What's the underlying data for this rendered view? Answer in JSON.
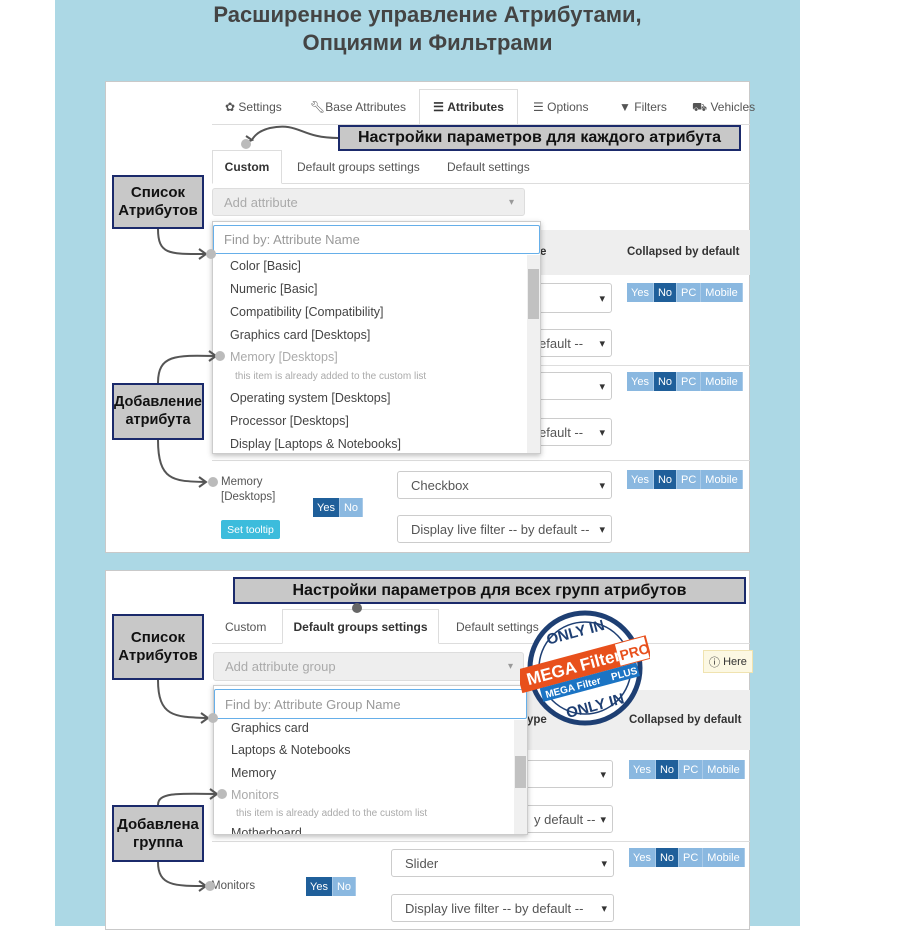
{
  "heading": {
    "line1": "Расширенное управление Атрибутами,",
    "line2": "Опциями и Фильтрами"
  },
  "colors": {
    "band": "#acd8e5",
    "callout_border": "#1b2a6b",
    "toggle_active": "#1f5f9a",
    "toggle_inactive": "#8ab8e0",
    "tooltip_button": "#3cbcdc"
  },
  "main_tabs": [
    {
      "label": "Settings",
      "icon": "gear-icon"
    },
    {
      "label": "Base Attributes",
      "icon": "wrench-icon"
    },
    {
      "label": "Attributes",
      "icon": "list-icon",
      "active": true
    },
    {
      "label": "Options",
      "icon": "list-icon"
    },
    {
      "label": "Filters",
      "icon": "filter-icon"
    },
    {
      "label": "Vehicles",
      "icon": "truck-icon"
    }
  ],
  "panel1": {
    "callout_top": "Настройки параметров для каждого атрибута",
    "callout_list": "Список Атрибутов",
    "callout_add": "Добавление атрибута",
    "subtabs": [
      "Custom",
      "Default groups settings",
      "Default settings"
    ],
    "active_subtab": "Custom",
    "add_placeholder": "Add attribute",
    "search_placeholder": "Find by: Attribute Name",
    "items": [
      "Color [Basic]",
      "Numeric [Basic]",
      "Compatibility [Compatibility]",
      "Graphics card [Desktops]",
      "Memory [Desktops]",
      "Operating system [Desktops]",
      "Processor [Desktops]",
      "Display [Laptops & Notebooks]"
    ],
    "disabled_item": "Memory [Desktops]",
    "disabled_note": "this item is already added to the custom list",
    "header_type_fragment": "e",
    "header_collapsed": "Collapsed by default",
    "select_fragment": "efault --",
    "row_label_line1": "Memory",
    "row_label_line2": "[Desktops]",
    "row_type": "Checkbox",
    "row_live": "Display live filter -- by default --",
    "yes": "Yes",
    "no": "No",
    "pc": "PC",
    "mobile": "Mobile",
    "set_tooltip": "Set tooltip"
  },
  "panel2": {
    "callout_top": "Настройки параметров для всех групп атрибутов",
    "callout_list": "Список Атрибутов",
    "callout_added": "Добавлена группа",
    "subtabs": [
      "Custom",
      "Default groups settings",
      "Default settings"
    ],
    "active_subtab": "Default groups settings",
    "add_placeholder": "Add attribute group",
    "search_placeholder": "Find by: Attribute Group Name",
    "items": [
      "Graphics card",
      "Laptops & Notebooks",
      "Memory",
      "Monitors",
      "Motherboard"
    ],
    "disabled_item": "Monitors",
    "disabled_note": "this item is already added to the custom list",
    "here": "Here",
    "header_type_fragment": "ype",
    "header_collapsed": "Collapsed by default",
    "select_fragment": "y default --",
    "row_label": "Monitors",
    "row_type": "Slider",
    "row_live": "Display live filter -- by default --",
    "yes": "Yes",
    "no": "No",
    "pc": "PC",
    "mobile": "Mobile"
  },
  "badge": {
    "top_text": "ONLY IN",
    "main": "MEGA Filter",
    "main_tag": "PRO",
    "sub": "MEGA Filter",
    "sub_tag": "PLUS",
    "bottom_text": "ONLY IN"
  }
}
